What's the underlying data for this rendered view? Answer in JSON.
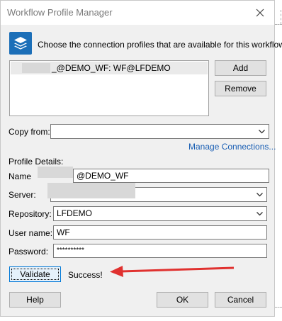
{
  "window": {
    "title": "Workflow Profile Manager"
  },
  "header": {
    "instruction": "Choose the connection profiles that are available for this workflow:"
  },
  "profiles_list": {
    "items": [
      {
        "label": "_@DEMO_WF: WF@LFDEMO"
      }
    ]
  },
  "buttons": {
    "add": "Add",
    "remove": "Remove",
    "validate": "Validate",
    "help": "Help",
    "ok": "OK",
    "cancel": "Cancel"
  },
  "copy_from": {
    "label": "Copy from:",
    "value": ""
  },
  "manage_link": "Manage Connections...",
  "profile_details": {
    "heading": "Profile Details:",
    "name_label": "Name",
    "name_value": "@DEMO_WF",
    "server_label": "Server:",
    "server_value": "",
    "repository_label": "Repository:",
    "repository_value": "LFDEMO",
    "username_label": "User name:",
    "username_value": "WF",
    "password_label": "Password:",
    "password_value": "**********"
  },
  "status": {
    "text": "Success!"
  },
  "colors": {
    "accent": "#0078d7",
    "link": "#1a5fb4",
    "annotation_arrow": "#e0312f",
    "icon_bg": "#1c6fb8"
  },
  "icons": [
    "layers-icon",
    "close-icon",
    "chevron-down-icon",
    "red-arrow-annotation"
  ]
}
